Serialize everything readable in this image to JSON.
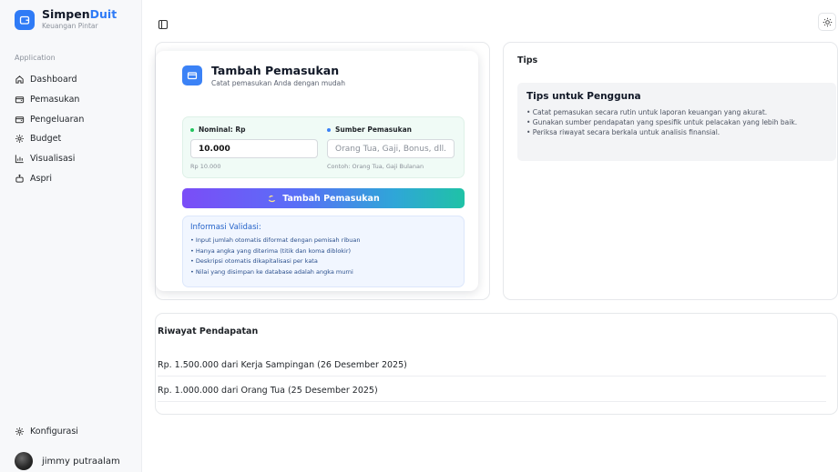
{
  "brand": {
    "name_primary": "Simpen",
    "name_accent": "Duit",
    "tagline": "Keuangan Pintar"
  },
  "sidebar": {
    "group_label": "Application",
    "items": [
      {
        "label": "Dashboard",
        "icon": "home-icon"
      },
      {
        "label": "Pemasukan",
        "icon": "wallet-icon"
      },
      {
        "label": "Pengeluaran",
        "icon": "wallet-icon"
      },
      {
        "label": "Budget",
        "icon": "gear-icon"
      },
      {
        "label": "Visualisasi",
        "icon": "bar-chart-icon"
      },
      {
        "label": "Aspri",
        "icon": "bot-icon"
      }
    ],
    "config_label": "Konfigurasi",
    "user_name": "jimmy putraalam"
  },
  "form": {
    "title": "Tambah Pemasukan",
    "subtitle": "Catat pemasukan Anda dengan mudah",
    "nominal": {
      "label": "Nominal: Rp",
      "value": "10.000",
      "hint": "Rp 10.000",
      "dot_color": "#22c55e"
    },
    "source": {
      "label": "Sumber Pemasukan",
      "placeholder": "Orang Tua, Gaji, Bonus, dll.",
      "hint": "Contoh: Orang Tua, Gaji Bulanan",
      "dot_color": "#3b82f6"
    },
    "submit_label": "Tambah Pemasukan",
    "info": {
      "title": "Informasi Validasi:",
      "lines": [
        "• Input jumlah otomatis diformat dengan pemisah ribuan",
        "• Hanya angka yang diterima (titik dan koma diblokir)",
        "• Deskripsi otomatis dikapitalisasi per kata",
        "• Nilai yang disimpan ke database adalah angka murni"
      ]
    }
  },
  "tips": {
    "header": "Tips",
    "title": "Tips untuk Pengguna",
    "lines": [
      "• Catat pemasukan secara rutin untuk laporan keuangan yang akurat.",
      "• Gunakan sumber pendapatan yang spesifik untuk pelacakan yang lebih baik.",
      "• Periksa riwayat secara berkala untuk analisis finansial."
    ]
  },
  "history": {
    "title": "Riwayat Pendapatan",
    "rows": [
      "Rp. 1.500.000 dari Kerja Sampingan (26 Desember 2025)",
      "Rp. 1.000.000 dari Orang Tua (25 Desember 2025)"
    ]
  },
  "colors": {
    "brand_blue": "#2f7bf6",
    "info_blue": "#2563c9"
  }
}
